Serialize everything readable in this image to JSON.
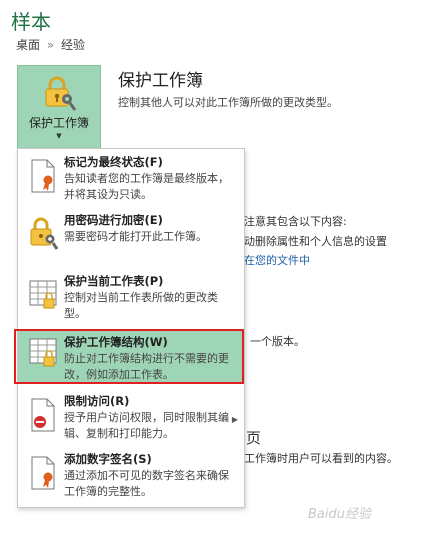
{
  "title": "样本",
  "breadcrumb": {
    "item1": "桌面",
    "sep": "»",
    "item2": "经验"
  },
  "protect_button": {
    "label": "保护工作簿"
  },
  "section": {
    "title": "保护工作簿",
    "description": "控制其他人可以对此工作簿所做的更改类型。"
  },
  "background": {
    "line1": "注意其包含以下内容:",
    "line2": "动删除属性和个人信息的设置",
    "line3": "在您的文件中",
    "line4": "一个版本。",
    "line5": "页",
    "line6": "工作簿时用户可以看到的内容。"
  },
  "menu": {
    "items": [
      {
        "label": "标记为最终状态(F)",
        "description": "告知读者您的工作簿是最终版本，并将其设为只读。"
      },
      {
        "label": "用密码进行加密(E)",
        "description": "需要密码才能打开此工作簿。"
      },
      {
        "label": "保护当前工作表(P)",
        "description": "控制对当前工作表所做的更改类型。"
      },
      {
        "label": "保护工作簿结构(W)",
        "description": "防止对工作簿结构进行不需要的更改，例如添加工作表。"
      },
      {
        "label": "限制访问(R)",
        "description": "授予用户访问权限，同时限制其编辑、复制和打印能力。"
      },
      {
        "label": "添加数字签名(S)",
        "description": "通过添加不可见的数字签名来确保工作簿的完整性。"
      }
    ]
  },
  "watermark": "Baidu经验",
  "colors": {
    "accent": "#217346",
    "highlight": "#9fd5b7",
    "red_box": "#e02020",
    "link": "#1e5fa8"
  }
}
